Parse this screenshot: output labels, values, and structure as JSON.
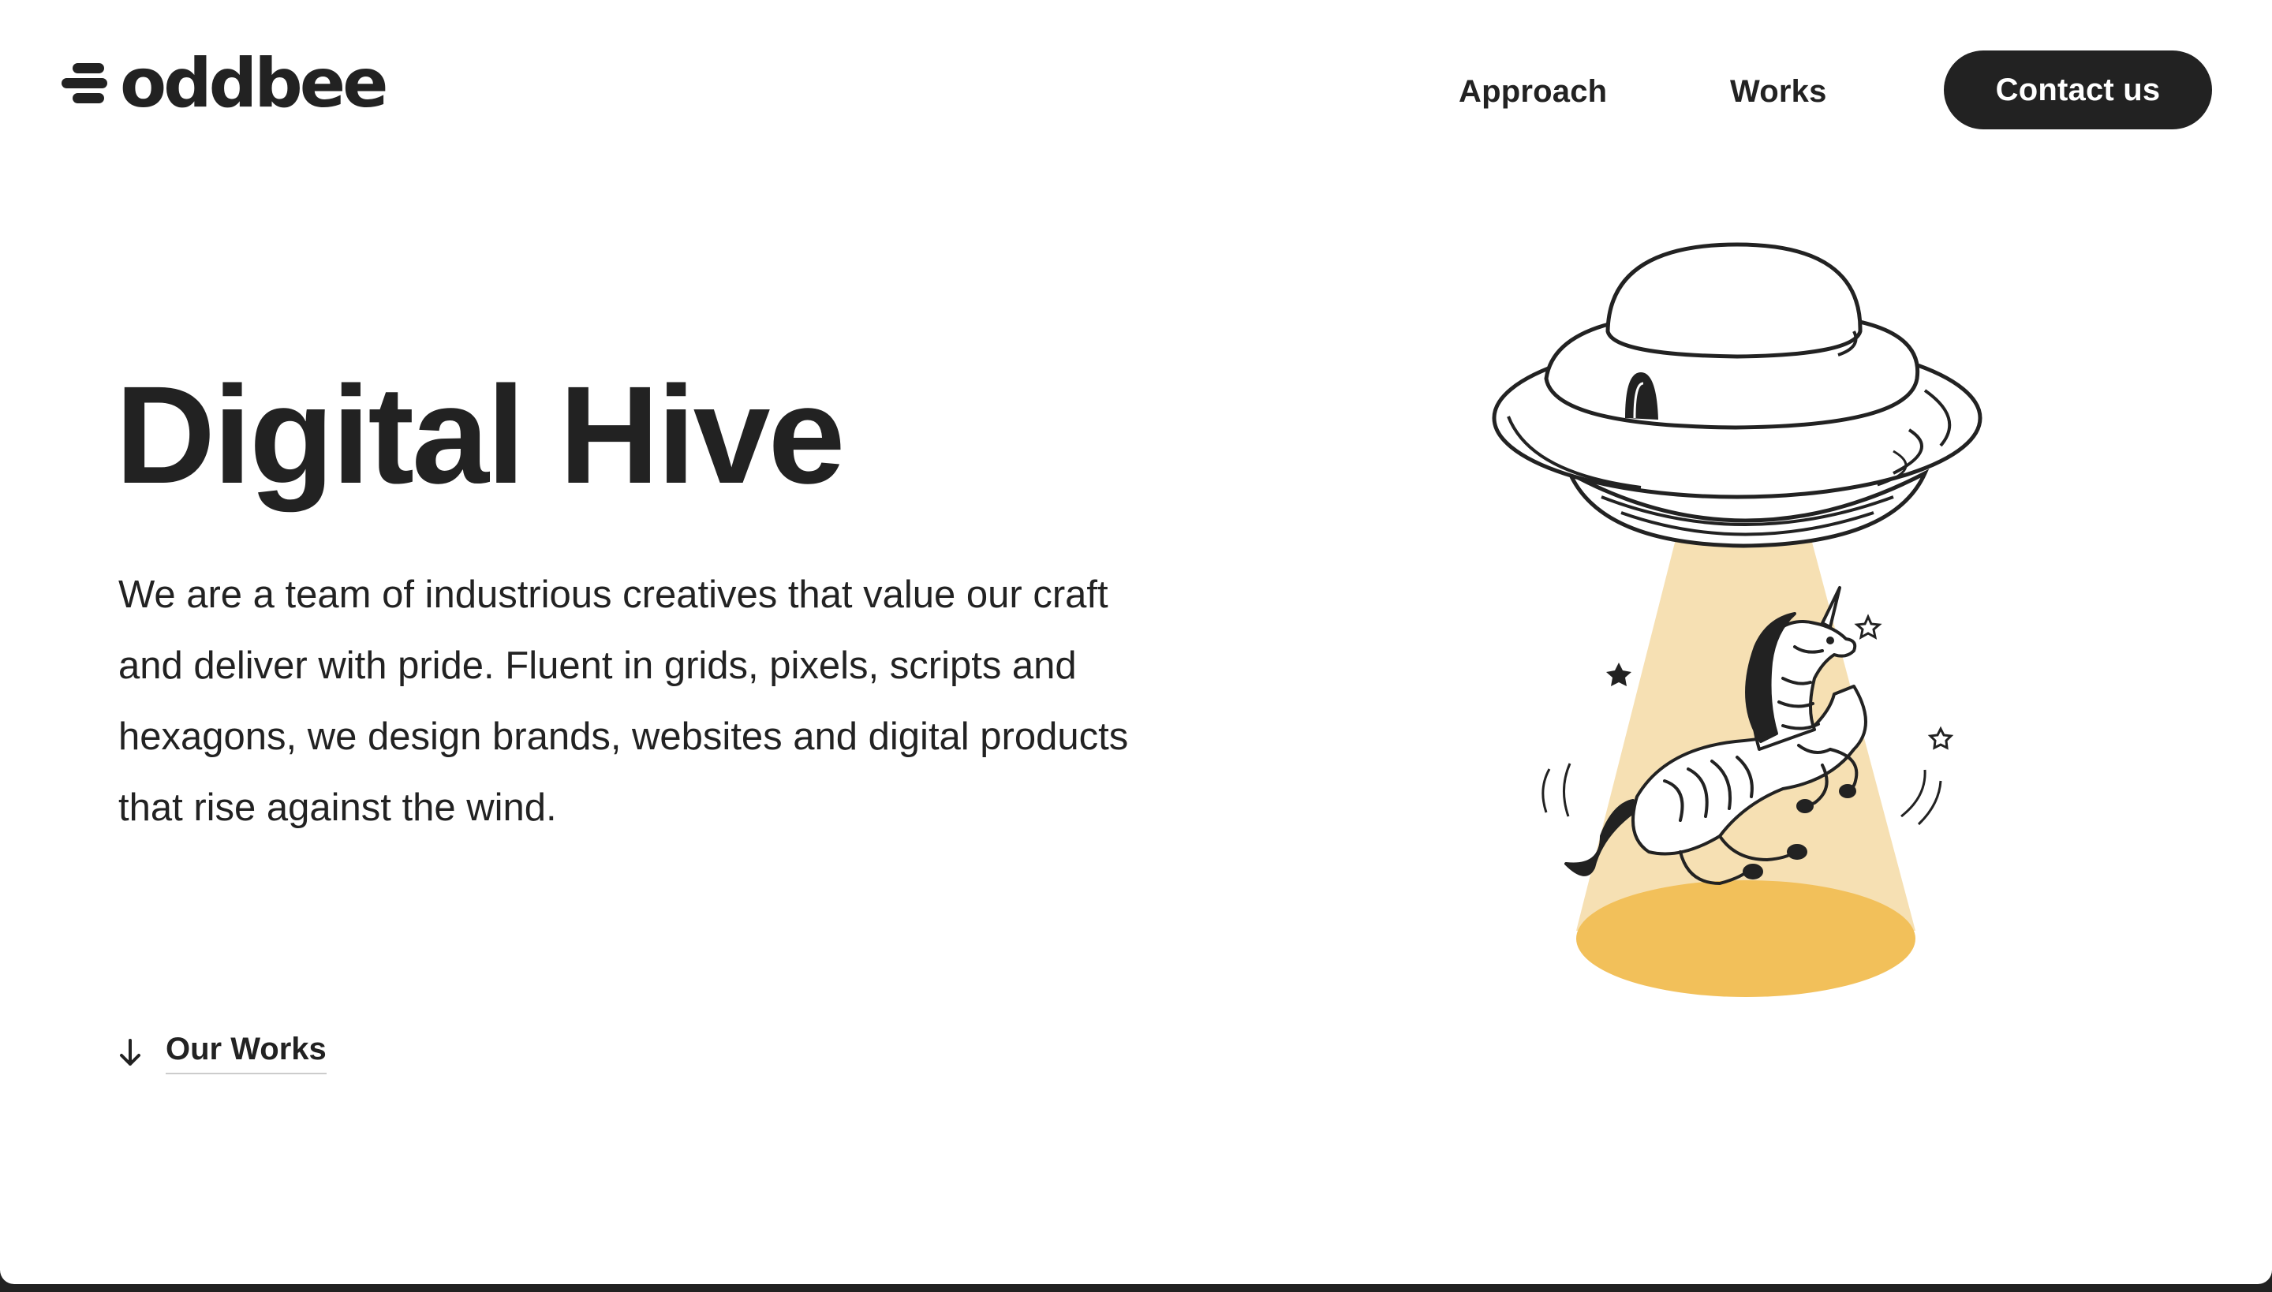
{
  "header": {
    "logo_text": "oddbee",
    "nav": [
      {
        "label": "Approach"
      },
      {
        "label": "Works"
      }
    ],
    "contact_label": "Contact us"
  },
  "hero": {
    "title": "Digital Hive",
    "description": "We are a team of industrious creatives that value our craft and deliver with pride. Fluent in grids, pixels, scripts and hexagons, we design brands, websites and digital products that rise against the wind.",
    "cta_label": "Our Works"
  },
  "illustration": {
    "subject": "ufo-abducting-zebra-unicorn",
    "colors": {
      "beam": "#F6E0B3",
      "spot": "#F2C05A",
      "ink": "#222222"
    }
  },
  "colors": {
    "text": "#222222",
    "background": "#FFFFFF",
    "button": "#222222",
    "button_text": "#FFFFFF"
  }
}
